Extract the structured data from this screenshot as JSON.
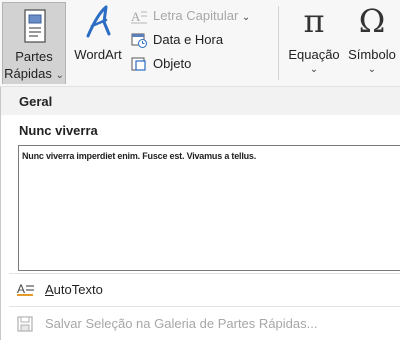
{
  "ribbon": {
    "partes_rapidas": {
      "line1": "Partes",
      "line2": "Rápidas",
      "chevron": "⌄"
    },
    "wordart": {
      "label": "WordArt"
    },
    "letra_capitular": {
      "label": "Letra Capitular",
      "chevron": "⌄"
    },
    "data_hora": {
      "label": "Data e Hora"
    },
    "objeto": {
      "label": "Objeto"
    },
    "equacao": {
      "symbol": "π",
      "label": "Equação",
      "chevron": "⌄"
    },
    "simbolo": {
      "symbol": "Ω",
      "label": "Símbolo",
      "chevron": "⌄"
    }
  },
  "panel": {
    "category": "Geral",
    "entry_title": "Nunc viverra",
    "entry_preview": "Nunc viverra imperdiet enim. Fusce est. Vivamus a tellus.",
    "autotexto": {
      "underlined": "A",
      "rest": "utoTexto"
    },
    "salvar": {
      "label": "Salvar Seleção na Galeria de Partes Rápidas..."
    }
  },
  "colors": {
    "ribbon_bg": "#f7f7f7",
    "active_button_bg": "#d2d2d2",
    "wordart_blue": "#2b6cc4",
    "disabled_text": "#a7a7a7"
  }
}
